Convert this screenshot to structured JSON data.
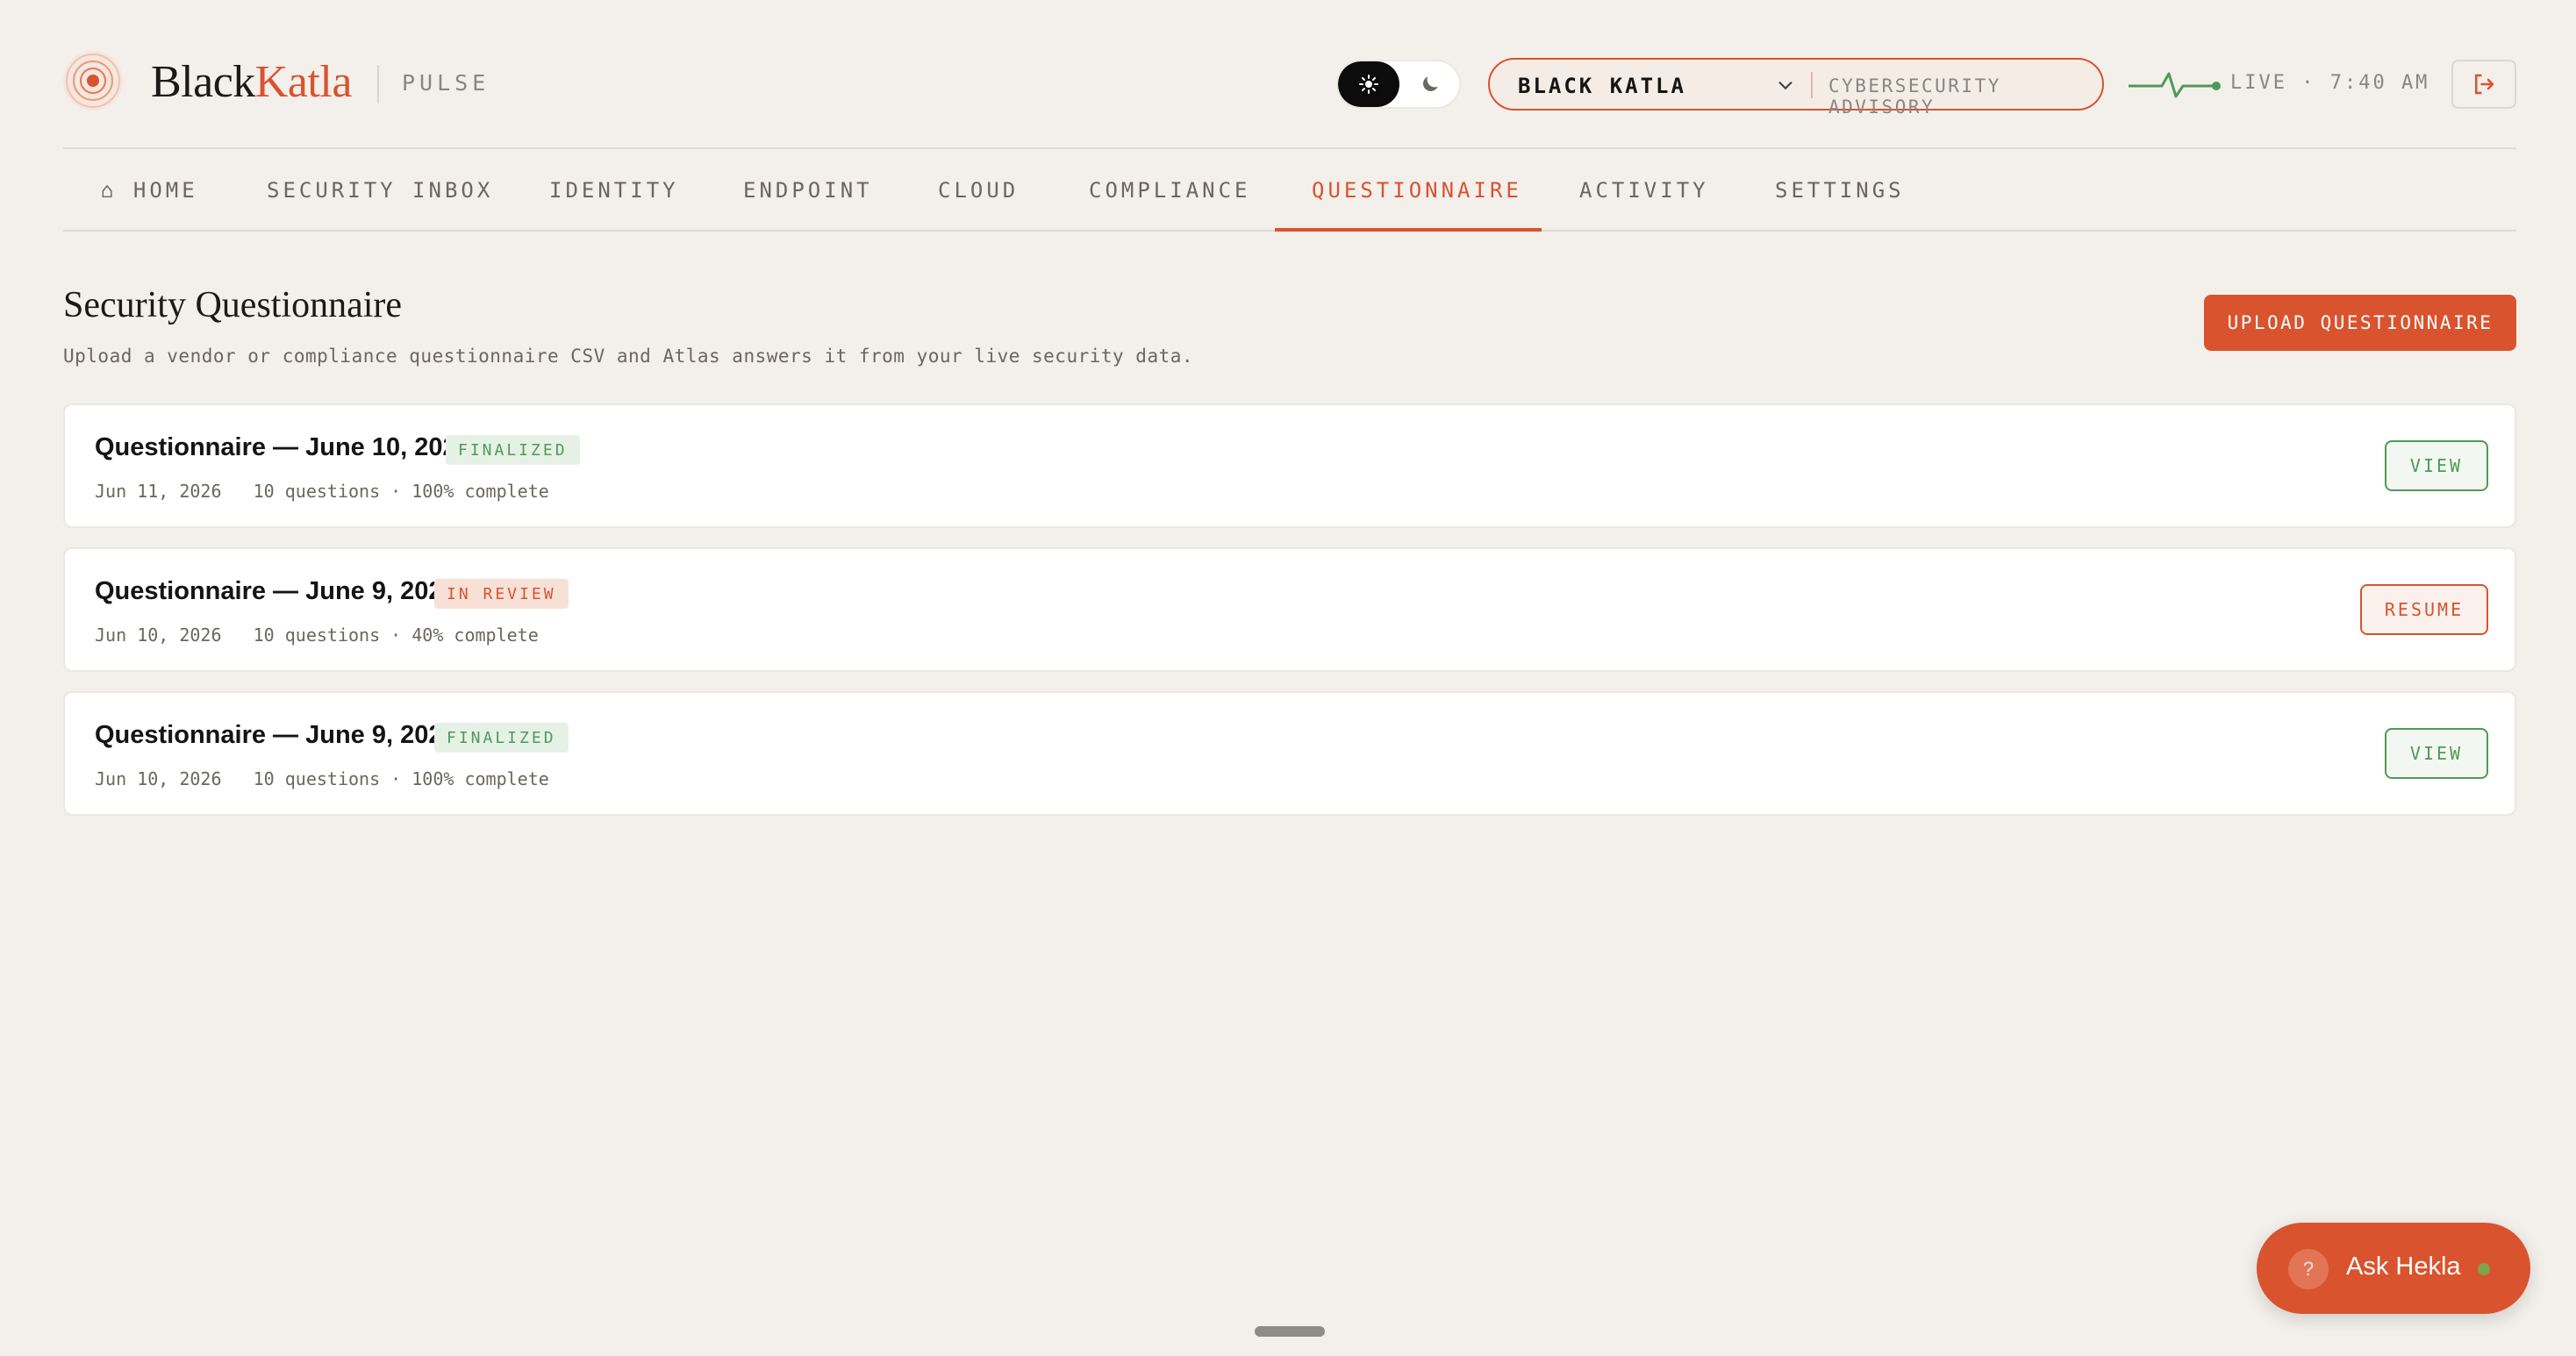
{
  "brand": {
    "name_part1": "Black",
    "name_part2": "Katla",
    "product": "PULSE",
    "logo_icon": "target-rings-icon"
  },
  "theme": {
    "light_icon": "sun-icon",
    "dark_icon": "moon-icon",
    "selected": "light"
  },
  "org": {
    "name": "BLACK KATLA",
    "tag": "CYBERSECURITY ADVISORY",
    "chevron_icon": "chevron-down-icon"
  },
  "status": {
    "live": "LIVE · 7:40 AM",
    "pulse_icon": "heartbeat-icon"
  },
  "logout_icon": "logout-icon",
  "nav": {
    "items": [
      {
        "label": "⌂ HOME"
      },
      {
        "label": "SECURITY INBOX"
      },
      {
        "label": "IDENTITY"
      },
      {
        "label": "ENDPOINT"
      },
      {
        "label": "CLOUD"
      },
      {
        "label": "COMPLIANCE"
      },
      {
        "label": "QUESTIONNAIRE"
      },
      {
        "label": "ACTIVITY"
      },
      {
        "label": "SETTINGS"
      }
    ],
    "active": "QUESTIONNAIRE"
  },
  "page": {
    "title": "Security Questionnaire",
    "subtitle": "Upload a vendor or compliance questionnaire CSV and Atlas answers it from your live security data.",
    "upload_label": "UPLOAD QUESTIONNAIRE"
  },
  "questionnaires": [
    {
      "title": "Questionnaire — June 10, 2026",
      "status": "FINALIZED",
      "date": "Jun 11, 2026",
      "questions": "10 questions",
      "progress": "100% complete",
      "action": "VIEW"
    },
    {
      "title": "Questionnaire — June 9, 2026",
      "status": "IN REVIEW",
      "date": "Jun 10, 2026",
      "questions": "10 questions",
      "progress": "40% complete",
      "action": "RESUME"
    },
    {
      "title": "Questionnaire — June 9, 2026",
      "status": "FINALIZED",
      "date": "Jun 10, 2026",
      "questions": "10 questions",
      "progress": "100% complete",
      "action": "VIEW"
    }
  ],
  "assistant": {
    "label": "Ask Hekla",
    "icon": "help-icon",
    "symbol": "?",
    "status": "online"
  },
  "colors": {
    "accent": "#d9532f",
    "success": "#4e9a58",
    "background": "#f3f0eb"
  }
}
